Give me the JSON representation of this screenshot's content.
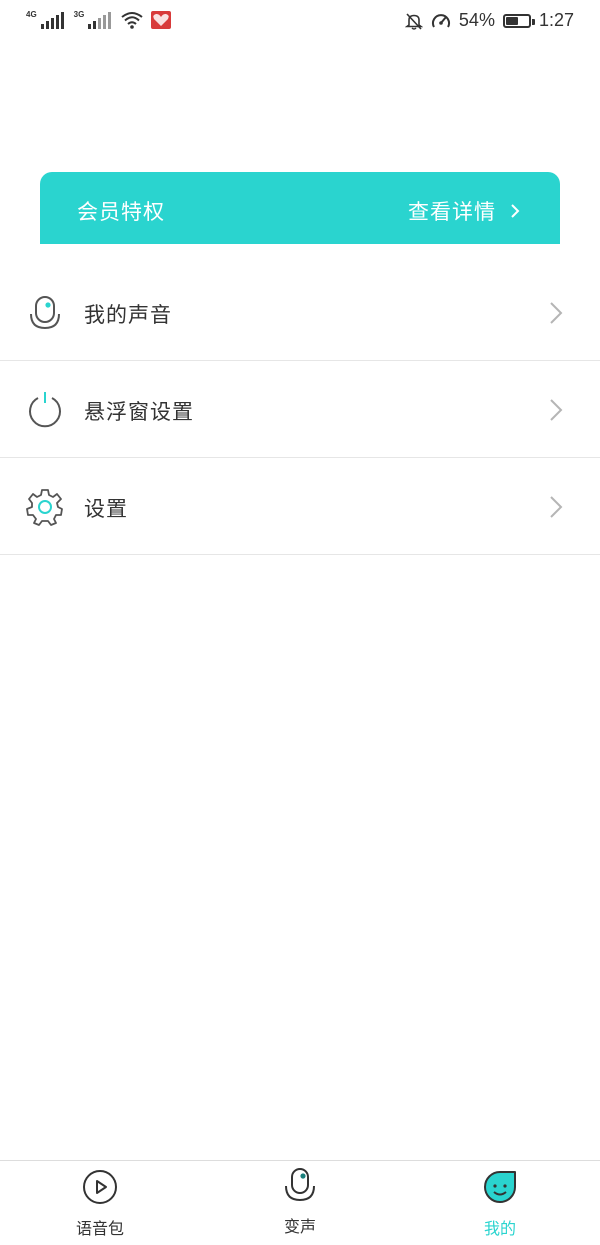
{
  "status_bar": {
    "network1": "4G",
    "network2": "3G",
    "battery_percent": "54%",
    "time": "1:27",
    "battery_level": 0.54
  },
  "vip_card": {
    "title": "会员特权",
    "detail_link": "查看详情",
    "color": "#2ad4cf"
  },
  "menu": {
    "items": [
      {
        "label": "我的声音",
        "icon": "microphone-icon"
      },
      {
        "label": "悬浮窗设置",
        "icon": "power-icon"
      },
      {
        "label": "设置",
        "icon": "gear-icon"
      }
    ]
  },
  "tab_bar": {
    "tabs": [
      {
        "label": "语音包",
        "icon": "play-circle-icon",
        "active": false
      },
      {
        "label": "变声",
        "icon": "microphone-icon",
        "active": false
      },
      {
        "label": "我的",
        "icon": "smiley-icon",
        "active": true
      }
    ],
    "active_color": "#2ad4cf"
  }
}
